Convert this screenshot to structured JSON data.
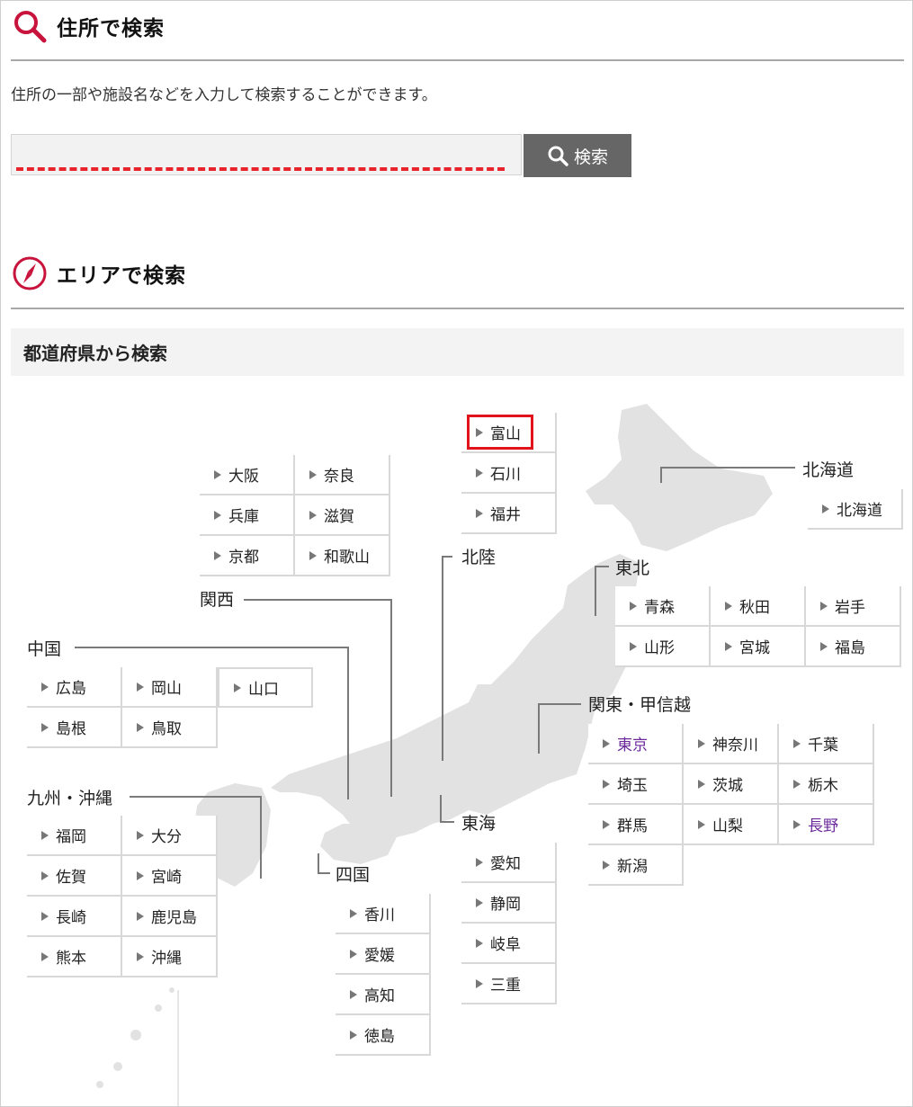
{
  "search": {
    "title": "住所で検索",
    "description": "住所の一部や施設名などを入力して検索することができます。",
    "input_value": "",
    "placeholder": "",
    "button_label": "検索"
  },
  "area": {
    "title": "エリアで検索",
    "subheading": "都道府県から検索"
  },
  "regions": {
    "kansai": {
      "label": "関西",
      "prefs": [
        "大阪",
        "奈良",
        "兵庫",
        "滋賀",
        "京都",
        "和歌山"
      ]
    },
    "hokuriku": {
      "label": "北陸",
      "prefs": [
        "富山",
        "石川",
        "福井"
      ],
      "highlighted": "富山"
    },
    "hokkaido": {
      "label": "北海道",
      "prefs": [
        "北海道"
      ]
    },
    "tohoku": {
      "label": "東北",
      "prefs": [
        "青森",
        "秋田",
        "岩手",
        "山形",
        "宮城",
        "福島"
      ]
    },
    "chugoku": {
      "label": "中国",
      "prefs": [
        "広島",
        "岡山",
        "山口",
        "島根",
        "鳥取"
      ]
    },
    "kanto": {
      "label": "関東・甲信越",
      "prefs": [
        "東京",
        "神奈川",
        "千葉",
        "埼玉",
        "茨城",
        "栃木",
        "群馬",
        "山梨",
        "長野",
        "新潟"
      ],
      "visited": [
        "東京",
        "長野"
      ]
    },
    "kyushu": {
      "label": "九州・沖縄",
      "prefs": [
        "福岡",
        "大分",
        "佐賀",
        "宮崎",
        "長崎",
        "鹿児島",
        "熊本",
        "沖縄"
      ]
    },
    "tokai": {
      "label": "東海",
      "prefs": [
        "愛知",
        "静岡",
        "岐阜",
        "三重"
      ]
    },
    "shikoku": {
      "label": "四国",
      "prefs": [
        "香川",
        "愛媛",
        "高知",
        "徳島"
      ]
    }
  },
  "colors": {
    "accent": "#c8143c",
    "highlight_box": "#e0141a",
    "visited_link": "#6b2a9c",
    "button_bg": "#666666",
    "dash": "#e8232b"
  },
  "icons": {
    "search": "magnifier-icon",
    "area": "compass-icon",
    "arrow": "triangle-right-icon"
  }
}
